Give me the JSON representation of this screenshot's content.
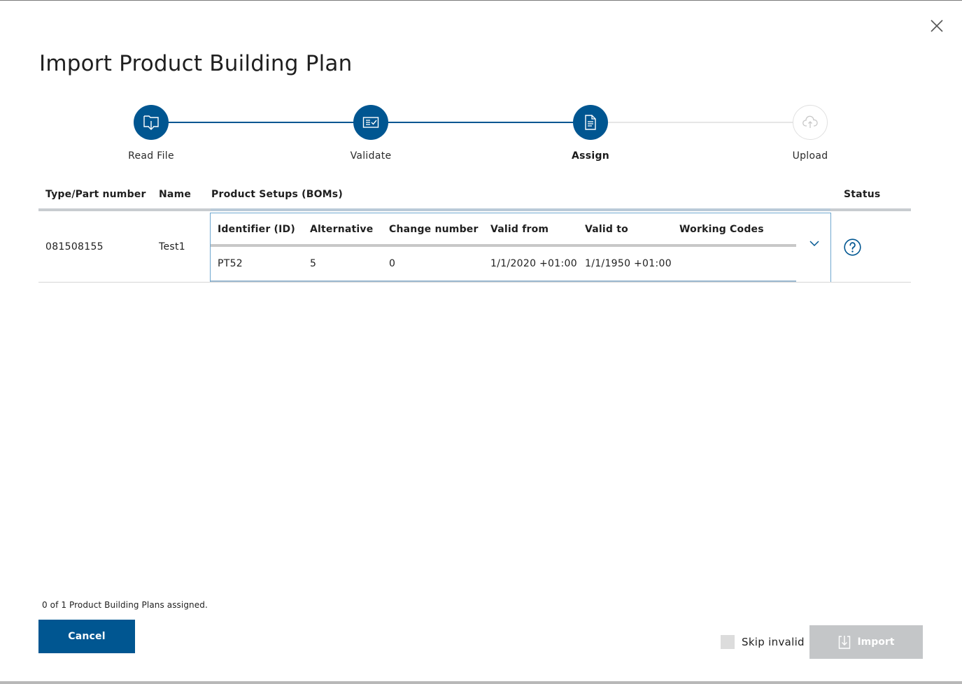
{
  "dialog": {
    "title": "Import Product Building Plan"
  },
  "stepper": {
    "steps": [
      {
        "label": "Read File",
        "icon": "folder-download-icon",
        "state": "done"
      },
      {
        "label": "Validate",
        "icon": "validate-check-icon",
        "state": "done"
      },
      {
        "label": "Assign",
        "icon": "document-icon",
        "state": "active"
      },
      {
        "label": "Upload",
        "icon": "cloud-upload-icon",
        "state": "todo"
      }
    ]
  },
  "table": {
    "headers": {
      "part_number": "Type/Part number",
      "name": "Name",
      "product_setups": "Product Setups (BOMs)",
      "status": "Status"
    },
    "rows": [
      {
        "part_number": "081508155",
        "name": "Test1",
        "status_icon": "question-icon",
        "bom": {
          "headers": [
            "Identifier (ID)",
            "Alternative",
            "Change number",
            "Valid from",
            "Valid to",
            "Working Codes"
          ],
          "values": [
            "PT52",
            "5",
            "0",
            "1/1/2020 +01:00",
            "1/1/1950 +01:00",
            ""
          ]
        }
      }
    ]
  },
  "footer": {
    "assigned_text": "0 of 1 Product Building Plans assigned.",
    "cancel_label": "Cancel",
    "skip_invalid_label": "Skip invalid",
    "import_label": "Import"
  },
  "colors": {
    "primary": "#005691",
    "disabled": "#c4c6c8"
  }
}
